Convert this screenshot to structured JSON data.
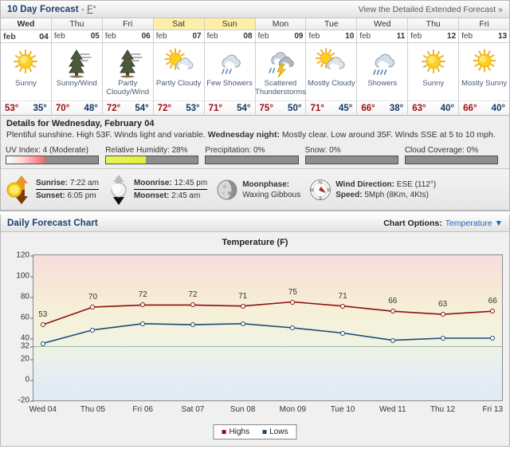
{
  "header": {
    "title": "10 Day Forecast",
    "unit_prefix": " - ",
    "unit": "F",
    "unit_sup": "°",
    "link": "View the Detailed Extended Forecast »"
  },
  "days": [
    {
      "dow": "Wed",
      "month": "feb",
      "date": "04",
      "condition": "Sunny",
      "icon": "sun-icon",
      "high": "53°",
      "low": "35°",
      "weekend": false,
      "today": true
    },
    {
      "dow": "Thu",
      "month": "feb",
      "date": "05",
      "condition": "Sunny/Wind",
      "icon": "sun-wind-icon",
      "high": "70°",
      "low": "48°",
      "weekend": false,
      "today": false
    },
    {
      "dow": "Fri",
      "month": "feb",
      "date": "06",
      "condition": "Partly Cloudy/Wind",
      "icon": "partly-cloudy-wind-icon",
      "high": "72°",
      "low": "54°",
      "weekend": false,
      "today": false
    },
    {
      "dow": "Sat",
      "month": "feb",
      "date": "07",
      "condition": "Partly Cloudy",
      "icon": "partly-cloudy-icon",
      "high": "72°",
      "low": "53°",
      "weekend": true,
      "today": false
    },
    {
      "dow": "Sun",
      "month": "feb",
      "date": "08",
      "condition": "Few Showers",
      "icon": "few-showers-icon",
      "high": "71°",
      "low": "54°",
      "weekend": true,
      "today": false
    },
    {
      "dow": "Mon",
      "month": "feb",
      "date": "09",
      "condition": "Scattered Thunderstorms",
      "icon": "thunderstorm-icon",
      "high": "75°",
      "low": "50°",
      "weekend": false,
      "today": false
    },
    {
      "dow": "Tue",
      "month": "feb",
      "date": "10",
      "condition": "Mostly Cloudy",
      "icon": "mostly-cloudy-icon",
      "high": "71°",
      "low": "45°",
      "weekend": false,
      "today": false
    },
    {
      "dow": "Wed",
      "month": "feb",
      "date": "11",
      "condition": "Showers",
      "icon": "showers-icon",
      "high": "66°",
      "low": "38°",
      "weekend": false,
      "today": false
    },
    {
      "dow": "Thu",
      "month": "feb",
      "date": "12",
      "condition": "Sunny",
      "icon": "sun-icon",
      "high": "63°",
      "low": "40°",
      "weekend": false,
      "today": false
    },
    {
      "dow": "Fri",
      "month": "feb",
      "date": "13",
      "condition": "Mostly Sunny",
      "icon": "mostly-sunny-icon",
      "high": "66°",
      "low": "40°",
      "weekend": false,
      "today": false
    }
  ],
  "details": {
    "title": "Details for Wednesday, February 04",
    "day_text": "Plentiful sunshine. High 53F. Winds light and variable.",
    "night_label": "Wednesday night:",
    "night_text": "Mostly clear. Low around 35F. Winds SSE at 5 to 10 mph."
  },
  "meters": [
    {
      "label": "UV Index: 4 (Moderate)",
      "pct": 42,
      "style": "uv"
    },
    {
      "label": "Relative Humidity: 28%",
      "pct": 43,
      "style": "humidity"
    },
    {
      "label": "Precipitation: 0%",
      "pct": 0,
      "style": "plain"
    },
    {
      "label": "Snow: 0%",
      "pct": 0,
      "style": "plain"
    },
    {
      "label": "Cloud Coverage: 0%",
      "pct": 0,
      "style": "plain"
    }
  ],
  "astro": {
    "sunrise_label": "Sunrise:",
    "sunrise": "7:22 am",
    "sunset_label": "Sunset:",
    "sunset": "6:05 pm",
    "moonrise_label": "Moonrise:",
    "moonrise": "12:45 pm",
    "moonset_label": "Moonset:",
    "moonset": "2:45 am",
    "moonphase_label": "Moonphase:",
    "moonphase": "Waxing Gibbous",
    "wind_dir_label": "Wind Direction:",
    "wind_dir": "ESE (112°)",
    "speed_label": "Speed:",
    "speed": "5Mph (8Km, 4Kts)"
  },
  "chart_panel": {
    "title": "Daily Forecast Chart",
    "options_label": "Chart Options:",
    "options_value": "Temperature",
    "caret": "▼"
  },
  "chart_data": {
    "type": "line",
    "title": "Temperature (F)",
    "xlabel": "",
    "ylabel": "",
    "ylim": [
      -20,
      120
    ],
    "yticks": [
      120,
      100,
      80,
      60,
      40,
      32,
      20,
      0,
      -20
    ],
    "grid": false,
    "freeze_line": 32,
    "legend_position": "bottom",
    "categories": [
      "Wed 04",
      "Thu 05",
      "Fri 06",
      "Sat 07",
      "Sun 08",
      "Mon 09",
      "Tue 10",
      "Wed 11",
      "Thu 12",
      "Fri 13"
    ],
    "series": [
      {
        "name": "Highs",
        "color": "#8c1010",
        "values": [
          53,
          70,
          72,
          72,
          71,
          75,
          71,
          66,
          63,
          66
        ],
        "labels": [
          "53",
          "70",
          "72",
          "72",
          "71",
          "75",
          "71",
          "66",
          "63",
          "66"
        ]
      },
      {
        "name": "Lows",
        "color": "#1c4a72",
        "values": [
          35,
          48,
          54,
          53,
          54,
          50,
          45,
          38,
          40,
          40
        ],
        "labels": []
      }
    ]
  }
}
